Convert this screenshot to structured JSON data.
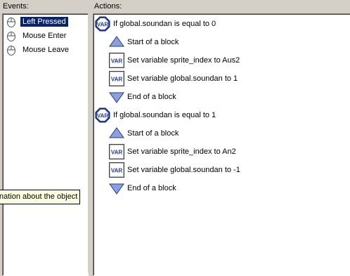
{
  "events_label": "Events:",
  "actions_label": "Actions:",
  "events": [
    {
      "label": "Left Pressed",
      "icon": "mouse-icon",
      "selected": true
    },
    {
      "label": "Mouse Enter",
      "icon": "mouse-icon",
      "selected": false
    },
    {
      "label": "Mouse Leave",
      "icon": "mouse-icon",
      "selected": false
    }
  ],
  "actions": [
    {
      "icon": "var-test-icon",
      "text": "If global.soundan is equal to 0",
      "indent": false
    },
    {
      "icon": "start-block-icon",
      "text": "Start of a block",
      "indent": true
    },
    {
      "icon": "var-set-icon",
      "text": "Set variable sprite_index to Aus2",
      "indent": true
    },
    {
      "icon": "var-set-icon",
      "text": "Set variable global.soundan to 1",
      "indent": true
    },
    {
      "icon": "end-block-icon",
      "text": "End of a block",
      "indent": true
    },
    {
      "icon": "var-test-icon",
      "text": "If global.soundan is equal to 1",
      "indent": false
    },
    {
      "icon": "start-block-icon",
      "text": "Start of a block",
      "indent": true
    },
    {
      "icon": "var-set-icon",
      "text": "Set variable sprite_index to An2",
      "indent": true
    },
    {
      "icon": "var-set-icon",
      "text": "Set variable global.soundan to -1",
      "indent": true
    },
    {
      "icon": "end-block-icon",
      "text": "End of a block",
      "indent": true
    }
  ],
  "icon_text": "VAR",
  "tooltip": "nation about the object",
  "colors": {
    "selection": "#0a246a",
    "window_bg": "#d4d0c8",
    "tooltip_bg": "#ffffe1",
    "var_icon": "#1f3a8a",
    "triangle": "#8c9fe0"
  }
}
